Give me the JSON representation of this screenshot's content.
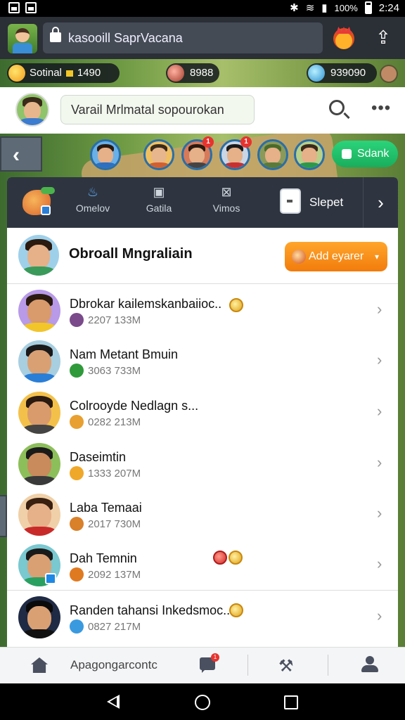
{
  "status_bar": {
    "battery": "100%",
    "time": "2:24"
  },
  "browser": {
    "url": "kasooill SaprVacana",
    "icons": [
      "lock-icon",
      "crown-icon",
      "share-icon"
    ]
  },
  "resources": {
    "coins_label": "Sotinal",
    "coins_value": "1490",
    "chest_value": "8988",
    "gems_value": "939090"
  },
  "header": {
    "message": "Varail Mrlmatal sopourokan"
  },
  "strip": {
    "badges": [
      "1",
      "1"
    ],
    "button_label": "Sdank"
  },
  "tabs": {
    "items": [
      "Omelov",
      "Gatila",
      "Vimos"
    ],
    "active": "Slepet",
    "icons": [
      "fire-icon",
      "card-icon",
      "swords-icon"
    ]
  },
  "panel": {
    "owner_name": "Obroall Mngraliain",
    "add_button": "Add eyarer"
  },
  "friends": [
    {
      "name": "Dbrokar kailemskanbaiioc..",
      "sub": "2207 133M"
    },
    {
      "name": "Nam Metant Bmuin",
      "sub": "3063 733M"
    },
    {
      "name": "Colrooyde Nedlagn s...",
      "sub": "0282 213M"
    },
    {
      "name": "Daseimtin",
      "sub": "1333 207M"
    },
    {
      "name": "Laba Temaai",
      "sub": "2017 730M"
    },
    {
      "name": "Dah Temnin",
      "sub": "2092 137M"
    },
    {
      "name": "Randen tahansi Inkedsmoc..",
      "sub": "0827 217M"
    }
  ],
  "bottom_nav": {
    "label": "Apagongarcontc",
    "badge": "1"
  },
  "colors": {
    "accent_green": "#19ad5c",
    "accent_orange": "#f27c0c",
    "tab_bar": "#2e3540"
  }
}
